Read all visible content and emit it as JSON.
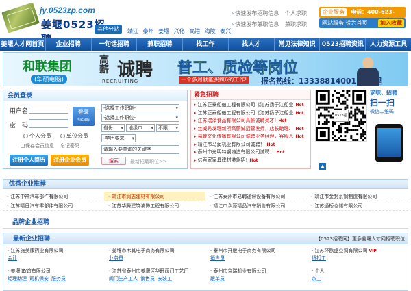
{
  "header": {
    "url": "jy.0523zp.com",
    "brand": "姜堰0523招聘",
    "city_button": "其他分站",
    "cities": [
      "靖江",
      "泰州",
      "姜堰",
      "兴化",
      "高港",
      "海陵",
      "泰兴"
    ],
    "quick_links_left": [
      "快速发布招聘信息",
      "快速发布兼职信息"
    ],
    "quick_links_right": [
      "个人求职",
      "兼职求职"
    ],
    "service_tag": "企业服务",
    "service_tel": "电话：400-623-0523",
    "service_line2": "网站服务  设为首页",
    "fav_label": "加入收藏"
  },
  "nav": [
    "姜堰人才网首页",
    "企业招聘",
    "一句话招聘",
    "兼职招聘",
    "找工作",
    "找人才",
    "常见法律知识",
    "0523招聘资讯",
    "人力资源工具"
  ],
  "banner": {
    "group": "和联集团",
    "group_sub": "(华硕电脑)",
    "gaoxin": "高薪",
    "chengpin": "诚聘",
    "recruiting": "RECRUITING",
    "positions": "普工、质检等岗位",
    "month": "一个多月就能买疯6的工作!",
    "hotline": "报名热线：13338814001 曹经理"
  },
  "login": {
    "title": "会员登录",
    "user_label": "用户名",
    "pwd_label": "密　码",
    "login_btn": "登录",
    "login_btn_en": "SIGNIN",
    "radio_person": "个人会员",
    "radio_company": "单位会员",
    "remember": "保存会员信息",
    "forgot": "忘记密码",
    "reg_person": "注册个人简历",
    "reg_company": "注册企业会员"
  },
  "search": {
    "sel_job_category": "-选择工作职能-",
    "sel_job_position": "-选择工作职位-",
    "sel_province": "省份",
    "sel_city": "地级市",
    "sel_unlimited": "不限",
    "sel_education": "-学历要求-",
    "keyword_placeholder": "请输入要查询的关键字",
    "search_btn": "搜索",
    "recent_label": "最新招聘职位>>"
  },
  "urgent": {
    "title": "紧急招聘",
    "items": [
      {
        "text": "江苏正泰船舶工程有限公司《江苏扬子江船业",
        "red": false
      },
      {
        "text": "江苏正泰船舶工程有限公司《江苏扬子江船业",
        "red": false
      },
      {
        "text": "江苏瑞泽食品有限公司高薪诚聘英才!",
        "red": true
      },
      {
        "text": "丝威秀发理新所高薪诚招营发师，店长助理、",
        "red": true
      },
      {
        "text": "易鞭文化传播有限公司诚聘业务经理，客服人",
        "red": true
      },
      {
        "text": "靖江市马润机业有限公司诚聘！",
        "red": false
      },
      {
        "text": "泰州市光明特钢铸造有限公司诚聘：",
        "red": false
      },
      {
        "text": "亿百家家具建材港急招!",
        "red": false
      }
    ],
    "hot": "Hot"
  },
  "qr": {
    "center": "0523招聘",
    "scan1": "求职、招聘",
    "scan2": "扫一扫",
    "scan3": "微信二维码"
  },
  "excellent": {
    "title": "优秀企业推荐",
    "rows": [
      [
        "江苏中祥汽车部件有限公司",
        "靖江市润志建材有限公司",
        "江苏泰州市易聘通讯设备有限公司",
        "靖江市金封系钢制造有限公司"
      ],
      [
        "江苏晴日汽车零部件有限公司",
        "江苏华腾建筑装饰工程有限公司",
        "靖江市众源精品汽车销售有限公司",
        "江苏通桥仓储有限公司"
      ]
    ],
    "highlight": "靖江市润志建材有限公司"
  },
  "brands_title": "品牌企业招聘",
  "latest": {
    "title": "最新企业招聘",
    "note": "【0523招聘网】更多姜堰人才网招聘职位",
    "cards": [
      {
        "company": "江苏施美康药业有限公司",
        "jobs": [
          "会计"
        ]
      },
      {
        "company": "姜堰市木其电子商务有限公司",
        "jobs": [
          "业务员"
        ]
      },
      {
        "company": "泰州市开殷电子商务有限公司",
        "jobs": [
          "销售员"
        ]
      },
      {
        "company": "江苏环欧盛空调有限公司",
        "jobs": [
          "纽扣工"
        ]
      },
      {
        "company": "姜堰滨/谊有限公司",
        "jobs": [
          "经理助理",
          "司机保安",
          "服务员"
        ]
      },
      {
        "company": "江苏省泰州市姜堰区华旺阀门工艺厂",
        "jobs": [
          "阀门生产工人",
          "销售员",
          "安装工"
        ]
      },
      {
        "company": "泰州市京瑞机业有限公司",
        "jobs": [
          "跟单员"
        ]
      },
      {
        "company": "个人",
        "jobs": [
          "杂工"
        ]
      }
    ],
    "vip": "VIP"
  }
}
